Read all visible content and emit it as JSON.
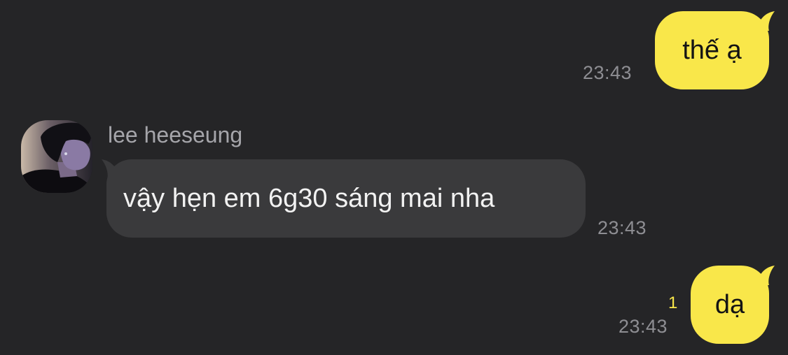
{
  "messages": [
    {
      "text": "thế ạ",
      "time": "23:43"
    },
    {
      "sender": "lee heeseung",
      "text": "vậy hẹn em 6g30 sáng mai nha",
      "time": "23:43",
      "avatar_icon": "profile-photo"
    },
    {
      "text": "dạ",
      "time": "23:43",
      "unread_count": "1"
    }
  ],
  "colors": {
    "background": "#252527",
    "outgoing_bubble": "#f9e74a",
    "incoming_bubble": "#3a3a3c",
    "unread_indicator": "#f9e74a"
  }
}
